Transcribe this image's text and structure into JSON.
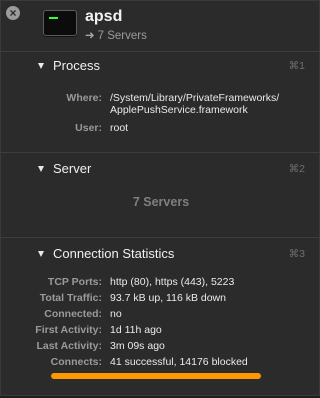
{
  "header": {
    "title": "apsd",
    "subtitle": "7 Servers",
    "subtitle_arrow": "➜"
  },
  "process": {
    "title": "Process",
    "shortcut": "⌘1",
    "where_label": "Where:",
    "where_value_line1": "/System/Library/PrivateFrameworks/",
    "where_value_line2": "ApplePushService.framework",
    "user_label": "User:",
    "user_value": "root"
  },
  "server": {
    "title": "Server",
    "shortcut": "⌘2",
    "count": "7 Servers"
  },
  "connection": {
    "title": "Connection Statistics",
    "shortcut": "⌘3",
    "rows": [
      {
        "label": "TCP Ports:",
        "value": "http (80), https (443), 5223"
      },
      {
        "label": "Total Traffic:",
        "value": "93.7 kB up, 116 kB down"
      },
      {
        "label": "Connected:",
        "value": "no"
      },
      {
        "label": "First Activity:",
        "value": "1d 11h ago"
      },
      {
        "label": "Last Activity:",
        "value": "3m 09s ago"
      },
      {
        "label": "Connects:",
        "value": "41 successful, 14176 blocked"
      }
    ]
  },
  "colors": {
    "highlight": "#ff9800"
  },
  "icons": [
    "close-icon",
    "terminal-icon",
    "disclosure-triangle-icon"
  ]
}
